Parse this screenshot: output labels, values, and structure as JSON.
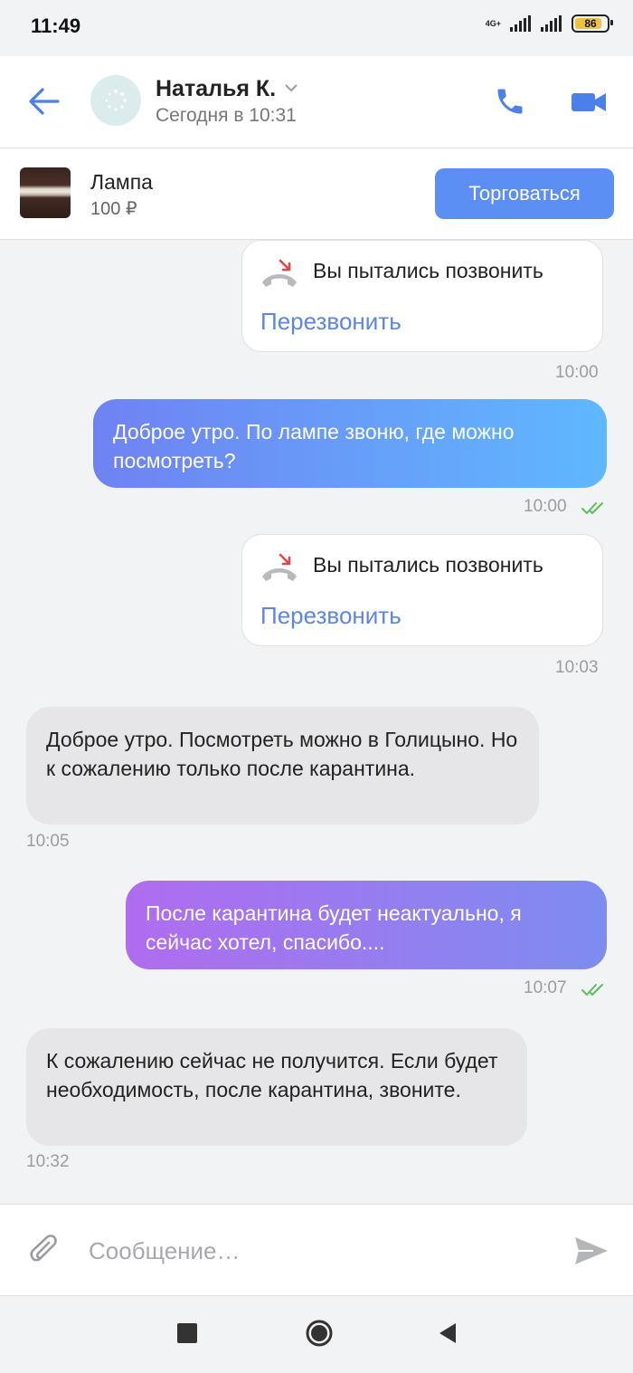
{
  "status_bar": {
    "time": "11:49",
    "network": "4G+",
    "battery": "86",
    "battery_level": 0.86
  },
  "header": {
    "contact_name": "Наталья К.",
    "last_seen": "Сегодня в 10:31"
  },
  "product": {
    "title": "Лампа",
    "price": "100 ₽",
    "bargain_label": "Торговаться"
  },
  "messages": [
    {
      "type": "missed_call",
      "text": "Вы пытались позвонить",
      "action": "Перезвонить",
      "time": "10:00"
    },
    {
      "type": "outgoing",
      "text": "Доброе утро. По лампе звоню, где можно посмотреть?",
      "time": "10:00",
      "read": true
    },
    {
      "type": "missed_call",
      "text": "Вы пытались позвонить",
      "action": "Перезвонить",
      "time": "10:03"
    },
    {
      "type": "incoming",
      "text": "Доброе утро. Посмотреть можно в Голицыно. Но к сожалению только после карантина.",
      "time": "10:05"
    },
    {
      "type": "outgoing",
      "text": "После карантина будет неактуально, я сейчас хотел, спасибо....",
      "time": "10:07",
      "read": true
    },
    {
      "type": "incoming",
      "text": "К сожалению сейчас не получится. Если будет необходимость, после карантина, звоните.",
      "time": "10:32"
    }
  ],
  "composer": {
    "placeholder": "Сообщение…"
  },
  "colors": {
    "accent": "#5b8ff4",
    "link": "#5b86e6",
    "read_ticks": "#5cbf5c",
    "missed_call_red": "#e0474c"
  }
}
